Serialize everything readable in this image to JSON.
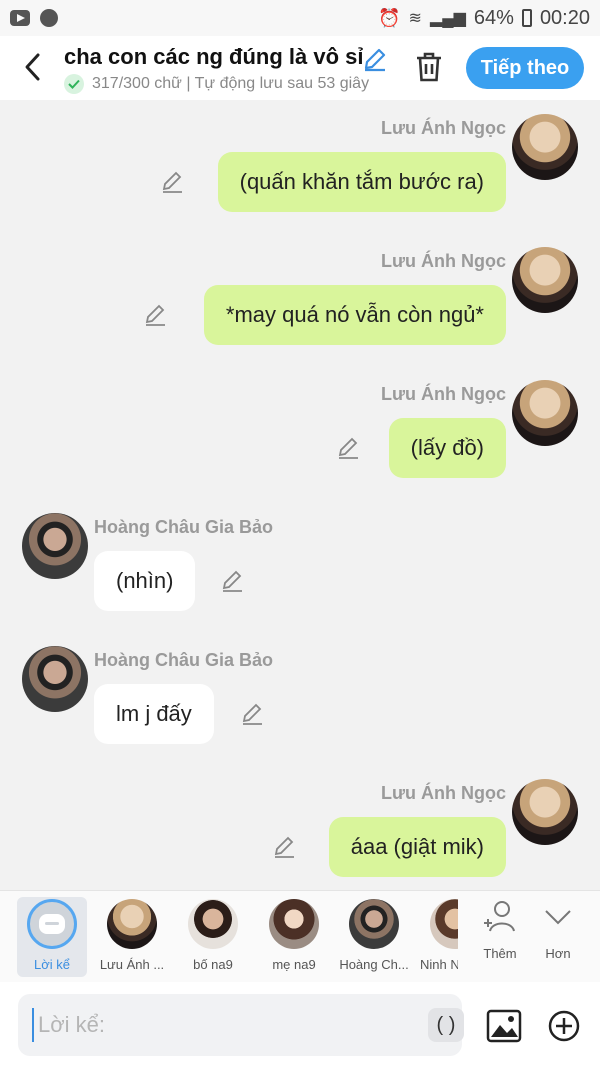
{
  "status_bar": {
    "battery": "64%",
    "time": "00:20"
  },
  "header": {
    "title": "cha con các ng đúng là vô sỉ",
    "subtitle": "317/300 chữ | Tự động lưu sau 53 giây",
    "next_label": "Tiếp theo"
  },
  "messages": [
    {
      "side": "right",
      "name": "Lưu Ánh Ngọc",
      "text": "(quấn khăn tắm bước ra)"
    },
    {
      "side": "right",
      "name": "Lưu Ánh Ngọc",
      "text": "*may quá nó vẫn còn ngủ*"
    },
    {
      "side": "right",
      "name": "Lưu Ánh Ngọc",
      "text": "(lấy đồ)"
    },
    {
      "side": "left",
      "name": "Hoàng Châu Gia Bảo",
      "text": "(nhìn)"
    },
    {
      "side": "left",
      "name": "Hoàng Châu Gia Bảo",
      "text": "lm j đấy"
    },
    {
      "side": "right",
      "name": "Lưu Ánh Ngọc",
      "text": "áaa (giật mik)"
    }
  ],
  "characters": [
    {
      "label": "Lời kể"
    },
    {
      "label": "Lưu Ánh ..."
    },
    {
      "label": "bố na9"
    },
    {
      "label": "mẹ na9"
    },
    {
      "label": "Hoàng Ch..."
    },
    {
      "label": "Ninh N"
    }
  ],
  "bar_actions": {
    "add_label": "Thêm",
    "more_label": "Hơn"
  },
  "input": {
    "placeholder": "Lời kể:",
    "paren_label": "( )"
  },
  "colors": {
    "accent": "#3aa0f0",
    "bubble_right": "#d9f59b",
    "bubble_left": "#ffffff"
  }
}
